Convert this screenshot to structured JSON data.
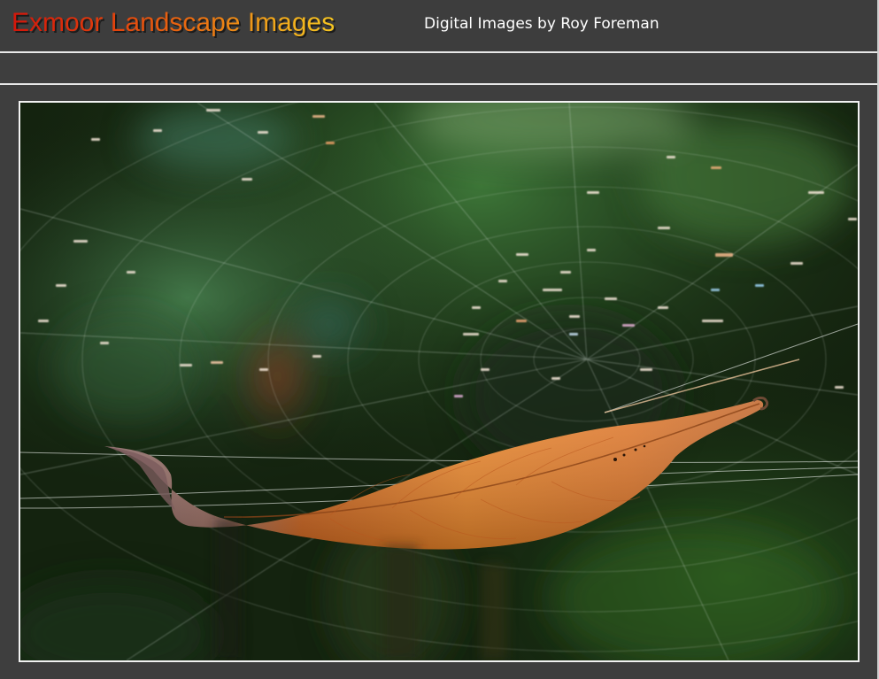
{
  "header": {
    "title": "Exmoor Landscape Images",
    "subtitle": "Digital Images by Roy Foreman"
  },
  "photo": {
    "subject": "leaf-in-spider-web-photo"
  },
  "colors": {
    "background": "#3e3e3e",
    "rule": "#e8e8e8",
    "title_gradient_start": "#d3160a",
    "title_gradient_end": "#f5c522",
    "subtitle": "#ffffff"
  }
}
